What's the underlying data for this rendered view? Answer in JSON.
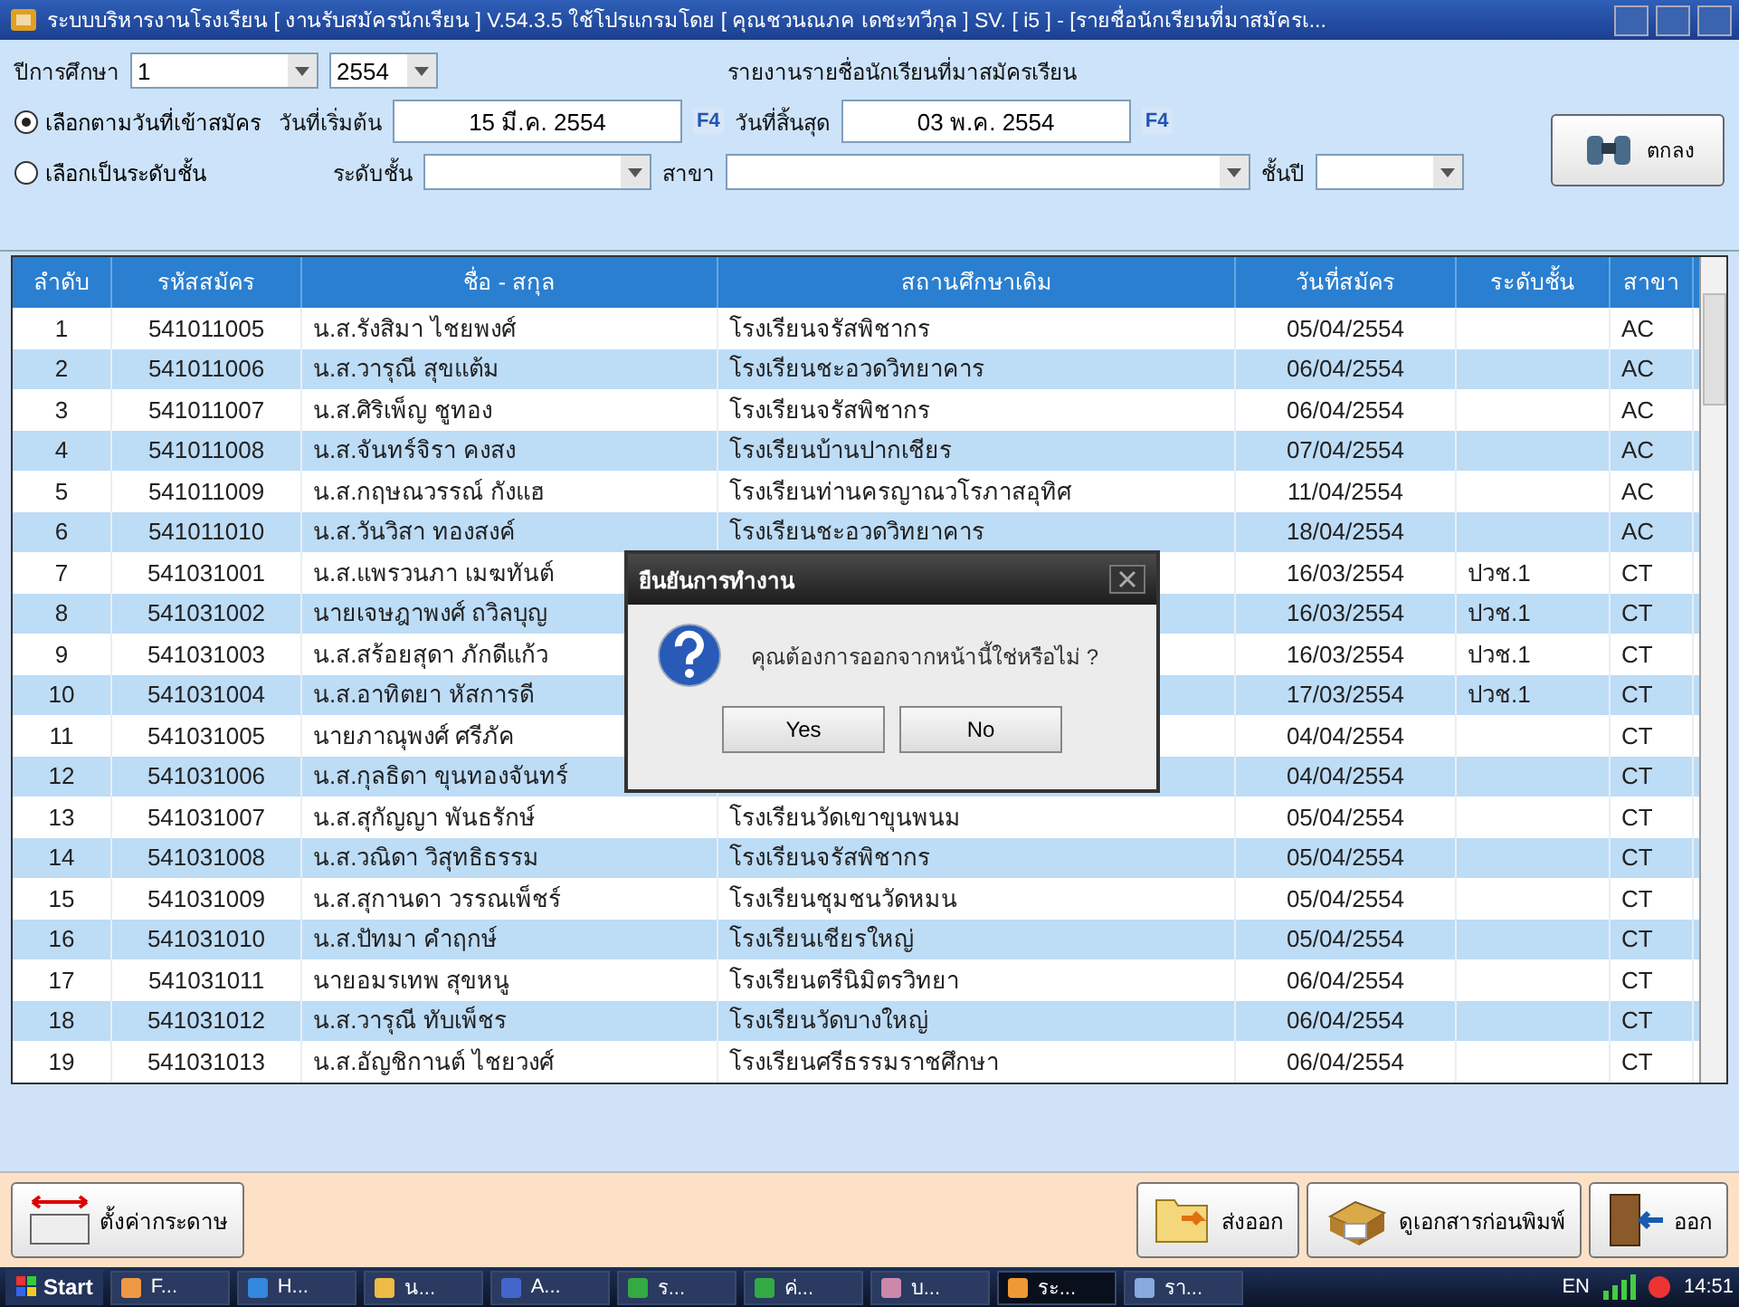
{
  "window": {
    "title": "ระบบบริหารงานโรงเรียน [ งานรับสมัครนักเรียน ] V.54.3.5 ใช้โปรแกรมโดย [ คุณชวนณภค  เดชะทวีกุล ] SV. [ i5 ] - [รายชื่อนักเรียนที่มาสมัครเ..."
  },
  "filters": {
    "year_label": "ปีการศึกษา",
    "term": "1",
    "year": "2554",
    "report_title": "รายงานรายชื่อนักเรียนที่มาสมัครเรียน",
    "options": [
      {
        "label": "เลือกตามวันที่เข้าสมัคร",
        "selected": true
      },
      {
        "label": "เลือกเป็นระดับชั้น",
        "selected": false
      }
    ],
    "start_label": "วันที่เริ่มต้น",
    "start_date": "15 มี.ค. 2554",
    "start_key": "F4",
    "end_label": "วันที่สิ้นสุด",
    "end_date": "03 พ.ค. 2554",
    "end_key": "F4",
    "level_label": "ระดับชั้น",
    "branch_label": "สาขา",
    "class_year_label": "ชั้นปี",
    "ok_button": "ตกลง"
  },
  "table": {
    "columns": [
      "ลำดับ",
      "รหัสสมัคร",
      "ชื่อ - สกุล",
      "สถานศึกษาเดิม",
      "วันที่สมัคร",
      "ระดับชั้น",
      "สาขา"
    ],
    "rows": [
      [
        "1",
        "541011005",
        "น.ส.รังสิมา ไชยพงศ์",
        "โรงเรียนจรัสพิชากร",
        "05/04/2554",
        null,
        "AC"
      ],
      [
        "2",
        "541011006",
        "น.ส.วารุณี สุขแต้ม",
        "โรงเรียนชะอวดวิทยาคาร",
        "06/04/2554",
        null,
        "AC"
      ],
      [
        "3",
        "541011007",
        "น.ส.ศิริเพ็ญ ชูทอง",
        "โรงเรียนจรัสพิชากร",
        "06/04/2554",
        null,
        "AC"
      ],
      [
        "4",
        "541011008",
        "น.ส.จันทร์จิรา คงสง",
        "โรงเรียนบ้านปากเชียร",
        "07/04/2554",
        null,
        "AC"
      ],
      [
        "5",
        "541011009",
        "น.ส.กฤษณวรรณ์ กังแฮ",
        "โรงเรียนท่านครญาณวโรภาสอุทิศ",
        "11/04/2554",
        null,
        "AC"
      ],
      [
        "6",
        "541011010",
        "น.ส.วันวิสา ทองสงค์",
        "โรงเรียนชะอวดวิทยาคาร",
        "18/04/2554",
        null,
        "AC"
      ],
      [
        "7",
        "541031001",
        "น.ส.แพรวนภา เมฆทันต์",
        null,
        "16/03/2554",
        "ปวช.1",
        "CT"
      ],
      [
        "8",
        "541031002",
        "นายเจษฎาพงศ์ ถวิลบุญ",
        null,
        "16/03/2554",
        "ปวช.1",
        "CT"
      ],
      [
        "9",
        "541031003",
        "น.ส.สร้อยสุดา ภักดีแก้ว",
        null,
        "16/03/2554",
        "ปวช.1",
        "CT"
      ],
      [
        "10",
        "541031004",
        "น.ส.อาทิตยา หัสการดี",
        null,
        "17/03/2554",
        "ปวช.1",
        "CT"
      ],
      [
        "11",
        "541031005",
        "นายภาณุพงศ์ ศรีภัค",
        null,
        "04/04/2554",
        null,
        "CT"
      ],
      [
        "12",
        "541031006",
        "น.ส.กุลธิดา ขุนทองจันทร์",
        null,
        "04/04/2554",
        null,
        "CT"
      ],
      [
        "13",
        "541031007",
        "น.ส.สุกัญญา พันธรักษ์",
        "โรงเรียนวัดเขาขุนพนม",
        "05/04/2554",
        null,
        "CT"
      ],
      [
        "14",
        "541031008",
        "น.ส.วณิดา วิสุทธิธรรม",
        "โรงเรียนจรัสพิชากร",
        "05/04/2554",
        null,
        "CT"
      ],
      [
        "15",
        "541031009",
        "น.ส.สุกานดา วรรณเพ็ชร์",
        "โรงเรียนชุมชนวัดหมน",
        "05/04/2554",
        null,
        "CT"
      ],
      [
        "16",
        "541031010",
        "น.ส.ปัทมา คำฤกษ์",
        "โรงเรียนเชียรใหญ่",
        "05/04/2554",
        null,
        "CT"
      ],
      [
        "17",
        "541031011",
        "นายอมรเทพ สุขหนู",
        "โรงเรียนตรีนิมิตรวิทยา",
        "06/04/2554",
        null,
        "CT"
      ],
      [
        "18",
        "541031012",
        "น.ส.วารุณี ทับเพ็ชร",
        "โรงเรียนวัดบางใหญ่",
        "06/04/2554",
        null,
        "CT"
      ],
      [
        "19",
        "541031013",
        "น.ส.อัญชิกานต์ ไชยวงศ์",
        "โรงเรียนศรีธรรมราชศึกษา",
        "06/04/2554",
        null,
        "CT"
      ]
    ]
  },
  "dialog": {
    "title": "ยืนยันการทำงาน",
    "message": "คุณต้องการออกจากหน้านี้ใช่หรือไม่ ?",
    "buttons": [
      "Yes",
      "No"
    ]
  },
  "bottom_buttons": [
    {
      "kind": "paper",
      "label": "ตั้งค่ากระดาษ"
    },
    {
      "kind": "export",
      "label": "ส่งออก"
    },
    {
      "kind": "print",
      "label": "ดูเอกสารก่อนพิมพ์"
    },
    {
      "kind": "exit",
      "label": "ออก"
    }
  ],
  "taskbar": {
    "start": "Start",
    "items": [
      {
        "label": "F...",
        "selected": false
      },
      {
        "label": "H...",
        "selected": false
      },
      {
        "label": "น...",
        "selected": false
      },
      {
        "label": "A...",
        "selected": false
      },
      {
        "label": "ร...",
        "selected": false
      },
      {
        "label": "ค่...",
        "selected": false
      },
      {
        "label": "บ...",
        "selected": false
      },
      {
        "label": "ระ...",
        "selected": true
      },
      {
        "label": "รา...",
        "selected": false
      }
    ],
    "language": "EN",
    "time": "14:51"
  }
}
